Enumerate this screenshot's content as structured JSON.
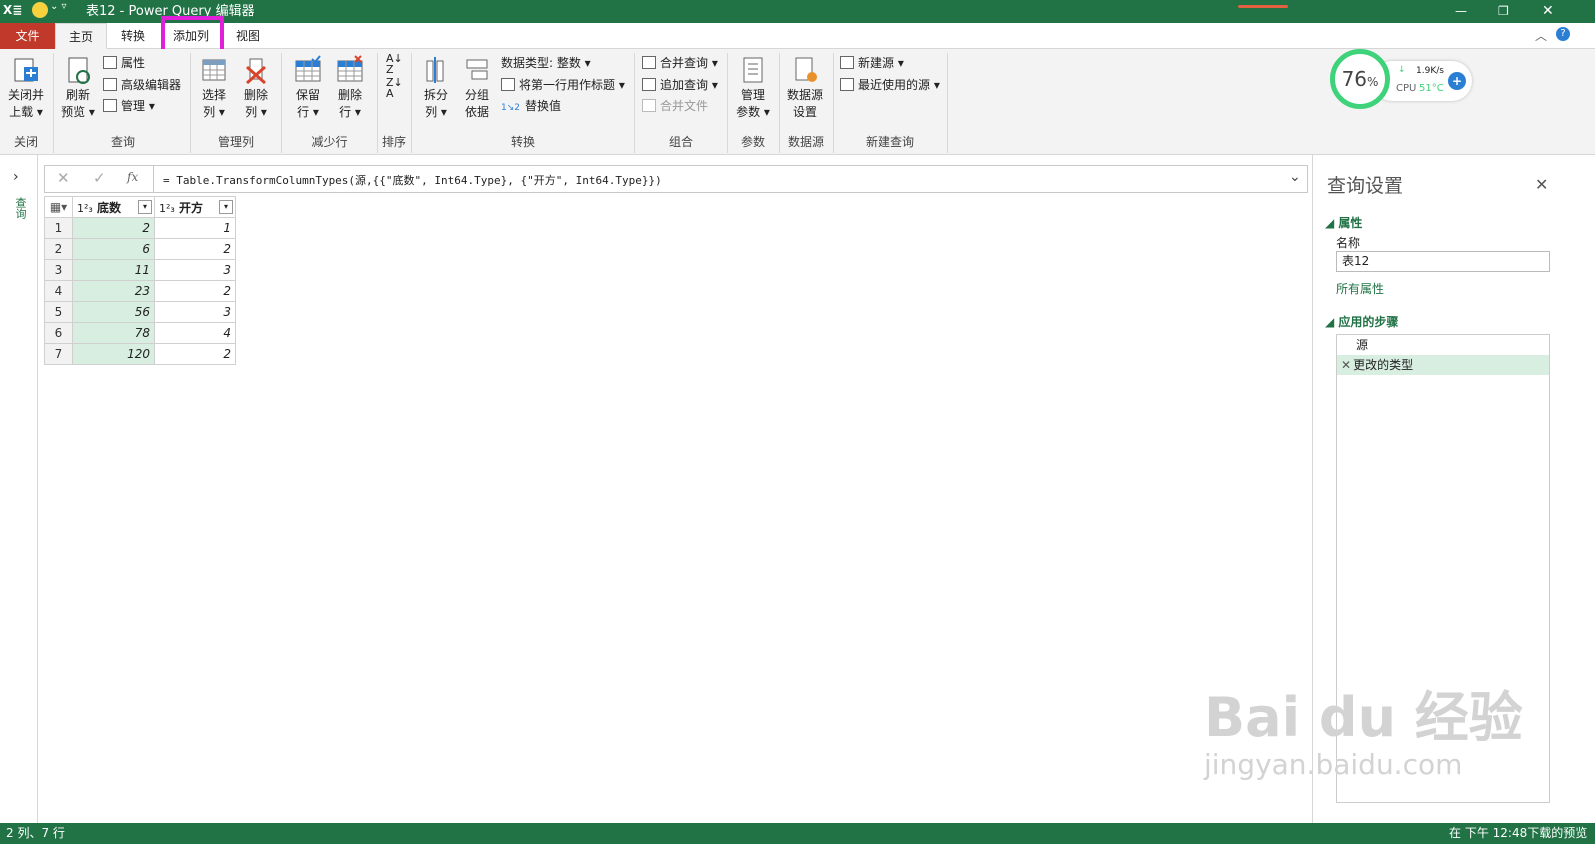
{
  "titlebar": {
    "title": "表12 - Power Query 编辑器",
    "app_icon": "excel-icon",
    "smile_icon": "smile-icon"
  },
  "tabs": {
    "file": "文件",
    "home": "主页",
    "transform": "转换",
    "add_column": "添加列",
    "view": "视图"
  },
  "ribbon": {
    "close": {
      "close_load": "关闭并",
      "close_load2": "上载 ▾",
      "label": "关闭"
    },
    "query": {
      "refresh": "刷新",
      "refresh2": "预览 ▾",
      "properties": "属性",
      "advanced_editor": "高级编辑器",
      "manage": "管理 ▾",
      "label": "查询"
    },
    "manage_columns": {
      "choose": "选择",
      "choose2": "列 ▾",
      "remove": "删除",
      "remove2": "列 ▾",
      "label": "管理列"
    },
    "reduce_rows": {
      "keep": "保留",
      "keep2": "行 ▾",
      "remove": "删除",
      "remove2": "行 ▾",
      "label": "减少行"
    },
    "sort": {
      "label": "排序"
    },
    "transform": {
      "split": "拆分",
      "split2": "列 ▾",
      "group": "分组",
      "group2": "依据",
      "data_type": "数据类型: 整数 ▾",
      "first_row": "将第一行用作标题 ▾",
      "replace": "替换值",
      "label": "转换"
    },
    "combine": {
      "merge": "合并查询 ▾",
      "append": "追加查询 ▾",
      "combine_files": "合并文件",
      "label": "组合"
    },
    "params": {
      "manage": "管理",
      "manage2": "参数 ▾",
      "label": "参数"
    },
    "datasource": {
      "settings": "数据源",
      "settings2": "设置",
      "label": "数据源"
    },
    "new_query": {
      "new_source": "新建源 ▾",
      "recent": "最近使用的源 ▾",
      "label": "新建查询"
    }
  },
  "widget": {
    "percent": "76",
    "unit": "%",
    "speed": "1.9K/s",
    "cpu": "CPU",
    "temp": "51°C"
  },
  "formula": {
    "text": "= Table.TransformColumnTypes(源,{{\"底数\", Int64.Type}, {\"开方\", Int64.Type}})",
    "fx": "fx"
  },
  "queries_pane_label": "查询",
  "table": {
    "type_icon": "1²₃",
    "columns": [
      "底数",
      "开方"
    ],
    "rows": [
      [
        "1",
        "2",
        "1"
      ],
      [
        "2",
        "6",
        "2"
      ],
      [
        "3",
        "11",
        "3"
      ],
      [
        "4",
        "23",
        "2"
      ],
      [
        "5",
        "56",
        "3"
      ],
      [
        "6",
        "78",
        "4"
      ],
      [
        "7",
        "120",
        "2"
      ]
    ]
  },
  "settings": {
    "title": "查询设置",
    "properties": "属性",
    "name_label": "名称",
    "name_value": "表12",
    "all_properties": "所有属性",
    "applied_steps": "应用的步骤",
    "steps": [
      "源",
      "更改的类型"
    ]
  },
  "watermark": {
    "brand": "Bai du 经验",
    "url": "jingyan.baidu.com"
  },
  "status": {
    "left": "2 列、7 行",
    "right": "在 下午 12:48下载的预览"
  },
  "colors": {
    "excel_green": "#217346",
    "file_red": "#c0392b",
    "highlight": "#e01fd8",
    "step_highlight": "#d8eee0"
  }
}
